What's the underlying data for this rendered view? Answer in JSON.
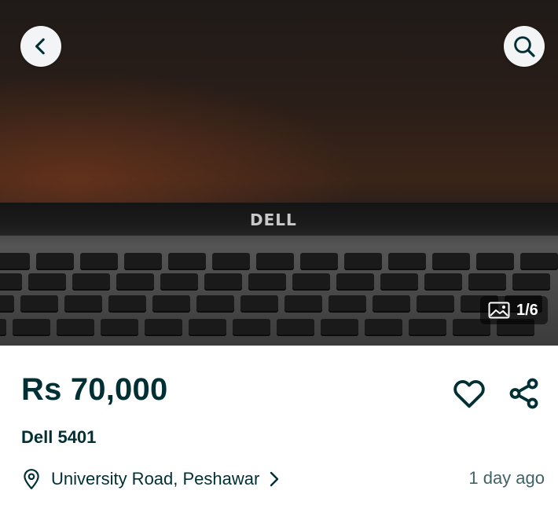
{
  "gallery": {
    "image_alt": "Dell laptop keyboard and screen",
    "brand_on_image": "DELL",
    "counter": "1/6"
  },
  "icons": {
    "back": "chevron-left-icon",
    "search": "search-icon",
    "gallery": "image-gallery-icon",
    "favorite": "heart-icon",
    "share": "share-icon",
    "location": "location-pin-icon",
    "location_more": "chevron-right-icon"
  },
  "listing": {
    "price": "Rs 70,000",
    "title": "Dell 5401",
    "location": "University Road, Peshawar",
    "posted": "1 day ago"
  },
  "colors": {
    "primary_text": "#002f34",
    "secondary_text": "#406367",
    "button_bg": "#f2f4f5",
    "counter_bg": "rgba(0,0,0,0.55)"
  }
}
